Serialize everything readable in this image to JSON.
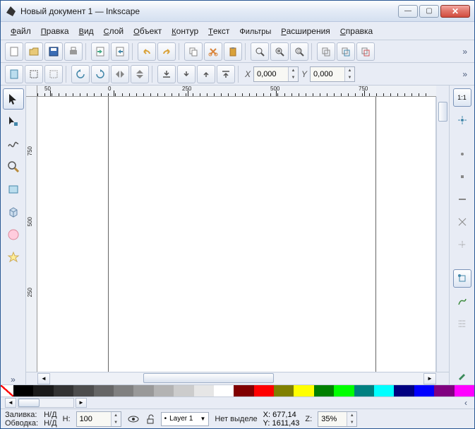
{
  "window": {
    "title": "Новый документ 1 — Inkscape"
  },
  "menu": {
    "file": "Файл",
    "edit": "Правка",
    "view": "Вид",
    "layer": "Слой",
    "object": "Объект",
    "path": "Контур",
    "text": "Текст",
    "filters": "Фильтры",
    "extensions": "Расширения",
    "help": "Справка"
  },
  "toolbar2": {
    "x_label": "X",
    "x_value": "0,000",
    "y_label": "Y",
    "y_value": "0,000"
  },
  "ruler": {
    "marks": [
      "50",
      "0",
      "250",
      "500",
      "750"
    ],
    "vmarks": [
      "750",
      "500",
      "250"
    ]
  },
  "status": {
    "fill_label": "Заливка:",
    "fill_value": "Н/Д",
    "stroke_label": "Обводка:",
    "stroke_value": "Н/Д",
    "h_label": "H:",
    "h_value": "100",
    "layer_prefix": "•",
    "layer": "Layer 1",
    "selection": "Нет выделе",
    "coord_x_label": "X:",
    "coord_x": "677,14",
    "coord_y_label": "Y:",
    "coord_y": "1611,43",
    "zoom_label": "Z:",
    "zoom": "35%"
  },
  "palette_colors": [
    "#000000",
    "#1a1a1a",
    "#333333",
    "#4d4d4d",
    "#666666",
    "#808080",
    "#999999",
    "#b3b3b3",
    "#cccccc",
    "#e6e6e6",
    "#ffffff",
    "#800000",
    "#ff0000",
    "#808000",
    "#ffff00",
    "#008000",
    "#00ff00",
    "#008080",
    "#00ffff",
    "#000080",
    "#0000ff",
    "#800080",
    "#ff00ff"
  ]
}
